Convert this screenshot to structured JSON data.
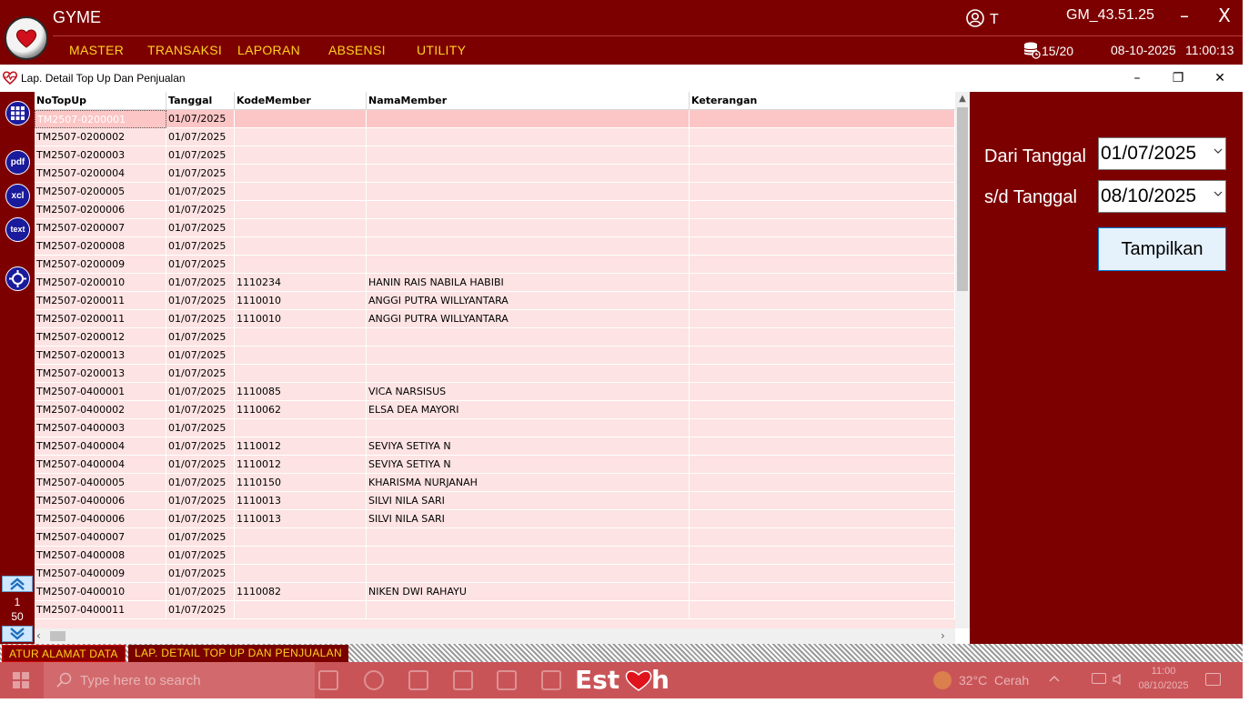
{
  "app": {
    "title": "GYME",
    "user": "T",
    "version": "GM_43.51.25",
    "minimize": "–",
    "close": "X",
    "db_count": "15/20",
    "date": "08-10-2025",
    "time": "11:00:13",
    "menu": [
      "MASTER",
      "TRANSAKSI",
      "LAPORAN",
      "ABSENSI",
      "UTILITY"
    ]
  },
  "window": {
    "title": "Lap. Detail Top Up Dan Penjualan",
    "min": "–",
    "restore": "❐",
    "close": "✕"
  },
  "toolbar": {
    "pdf": "pdf",
    "xcl": "xcl",
    "text": "text",
    "page_current": "1",
    "page_size": "50"
  },
  "grid": {
    "columns": [
      "NoTopUp",
      "Tanggal",
      "KodeMember",
      "NamaMember",
      "Keterangan"
    ],
    "rows": [
      [
        "TM2507-0200001",
        "01/07/2025",
        "",
        "",
        ""
      ],
      [
        "TM2507-0200002",
        "01/07/2025",
        "",
        "",
        ""
      ],
      [
        "TM2507-0200003",
        "01/07/2025",
        "",
        "",
        ""
      ],
      [
        "TM2507-0200004",
        "01/07/2025",
        "",
        "",
        ""
      ],
      [
        "TM2507-0200005",
        "01/07/2025",
        "",
        "",
        ""
      ],
      [
        "TM2507-0200006",
        "01/07/2025",
        "",
        "",
        ""
      ],
      [
        "TM2507-0200007",
        "01/07/2025",
        "",
        "",
        ""
      ],
      [
        "TM2507-0200008",
        "01/07/2025",
        "",
        "",
        ""
      ],
      [
        "TM2507-0200009",
        "01/07/2025",
        "",
        "",
        ""
      ],
      [
        "TM2507-0200010",
        "01/07/2025",
        "1110234",
        "HANIN RAIS NABILA HABIBI",
        ""
      ],
      [
        "TM2507-0200011",
        "01/07/2025",
        "1110010",
        "ANGGI PUTRA WILLYANTARA",
        ""
      ],
      [
        "TM2507-0200011",
        "01/07/2025",
        "1110010",
        "ANGGI PUTRA WILLYANTARA",
        ""
      ],
      [
        "TM2507-0200012",
        "01/07/2025",
        "",
        "",
        ""
      ],
      [
        "TM2507-0200013",
        "01/07/2025",
        "",
        "",
        ""
      ],
      [
        "TM2507-0200013",
        "01/07/2025",
        "",
        "",
        ""
      ],
      [
        "TM2507-0400001",
        "01/07/2025",
        "1110085",
        "VICA NARSISUS",
        ""
      ],
      [
        "TM2507-0400002",
        "01/07/2025",
        "1110062",
        "ELSA DEA MAYORI",
        ""
      ],
      [
        "TM2507-0400003",
        "01/07/2025",
        "",
        "",
        ""
      ],
      [
        "TM2507-0400004",
        "01/07/2025",
        "1110012",
        "SEVIYA SETIYA N",
        ""
      ],
      [
        "TM2507-0400004",
        "01/07/2025",
        "1110012",
        "SEVIYA SETIYA N",
        ""
      ],
      [
        "TM2507-0400005",
        "01/07/2025",
        "1110150",
        "KHARISMA NURJANAH",
        ""
      ],
      [
        "TM2507-0400006",
        "01/07/2025",
        "1110013",
        "SILVI NILA SARI",
        ""
      ],
      [
        "TM2507-0400006",
        "01/07/2025",
        "1110013",
        "SILVI NILA SARI",
        ""
      ],
      [
        "TM2507-0400007",
        "01/07/2025",
        "",
        "",
        ""
      ],
      [
        "TM2507-0400008",
        "01/07/2025",
        "",
        "",
        ""
      ],
      [
        "TM2507-0400009",
        "01/07/2025",
        "",
        "",
        ""
      ],
      [
        "TM2507-0400010",
        "01/07/2025",
        "1110082",
        "NIKEN DWI RAHAYU",
        ""
      ],
      [
        "TM2507-0400011",
        "01/07/2025",
        "",
        "",
        ""
      ]
    ]
  },
  "filter": {
    "from_label": "Dari Tanggal",
    "from_value": "01/07/2025",
    "to_label": "s/d Tanggal",
    "to_value": "08/10/2025",
    "show_button": "Tampilkan"
  },
  "tabs": [
    "ATUR ALAMAT DATA",
    "LAP. DETAIL TOP UP DAN PENJUALAN"
  ],
  "taskbar": {
    "search_placeholder": "Type here to search",
    "weather_temp": "32°C",
    "weather_desc": "Cerah",
    "tray_time": "11:00",
    "tray_date": "08/10/2025"
  },
  "colors": {
    "brand": "#7d0000",
    "menu_text": "#ffd21f",
    "row_bg": "#fde3e3",
    "row_selected": "#fcc6c6"
  }
}
